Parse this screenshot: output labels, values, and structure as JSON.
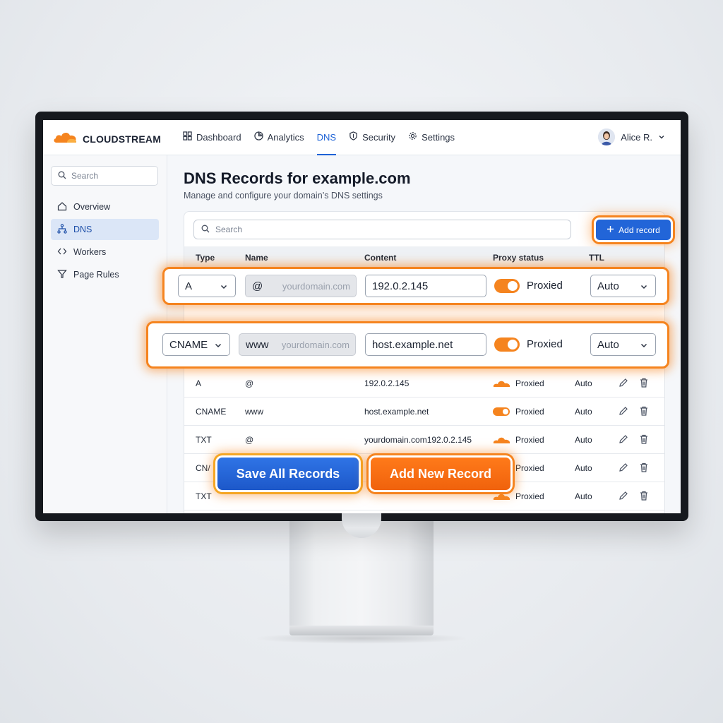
{
  "brand": {
    "name": "CLOUDSTREAM"
  },
  "nav": [
    {
      "label": "Dashboard",
      "icon": "grid-icon"
    },
    {
      "label": "Analytics",
      "icon": "pie-chart-icon"
    },
    {
      "label": "DNS",
      "icon": "",
      "active": true
    },
    {
      "label": "Security",
      "icon": "shield-icon"
    },
    {
      "label": "Settings",
      "icon": "gear-icon"
    }
  ],
  "user": {
    "name": "Alice R."
  },
  "sidebar": {
    "search_placeholder": "Search",
    "items": [
      {
        "label": "Overview",
        "icon": "home-icon"
      },
      {
        "label": "DNS",
        "icon": "network-icon",
        "active": true
      },
      {
        "label": "Workers",
        "icon": "code-icon"
      },
      {
        "label": "Page Rules",
        "icon": "filter-icon"
      }
    ]
  },
  "page": {
    "title": "DNS Records for example.com",
    "subtitle": "Manage and configure your domain’s DNS settings"
  },
  "table": {
    "search_placeholder": "Search",
    "add_record_label": "Add record",
    "columns": [
      "Type",
      "Name",
      "Content",
      "Proxy status",
      "TTL"
    ],
    "rows": [
      {
        "type": "A",
        "name": "@",
        "content": "192.0.2.145",
        "proxy": "Proxied",
        "proxy_icon": "cloud",
        "ttl": "Auto"
      },
      {
        "type": "CNAME",
        "name": "www",
        "content": "host.example.net",
        "proxy": "Proxied",
        "proxy_icon": "toggle",
        "ttl": "Auto"
      },
      {
        "type": "TXT",
        "name": "@",
        "content": "yourdomain.com192.0.2.145",
        "proxy": "Proxied",
        "proxy_icon": "cloud",
        "ttl": "Auto"
      },
      {
        "type": "CN/",
        "name": "",
        "content": "",
        "proxy": "Proxied",
        "proxy_icon": "cloud",
        "ttl": "Auto"
      },
      {
        "type": "TXT",
        "name": "",
        "content": "",
        "proxy": "Proxied",
        "proxy_icon": "cloud",
        "ttl": "Auto"
      }
    ]
  },
  "edit_rows": [
    {
      "type": "A",
      "name": "@",
      "name_hint": "yourdomain.com",
      "content": "192.0.2.145",
      "proxy": "Proxied",
      "ttl": "Auto"
    },
    {
      "type": "CNAME",
      "name": "www",
      "name_hint": "yourdomain.com",
      "content": "host.example.net",
      "proxy": "Proxied",
      "ttl": "Auto"
    }
  ],
  "buttons": {
    "save_all": "Save All Records",
    "add_new": "Add New Record"
  },
  "colors": {
    "accent_blue": "#2265d8",
    "accent_orange": "#f5841f"
  }
}
